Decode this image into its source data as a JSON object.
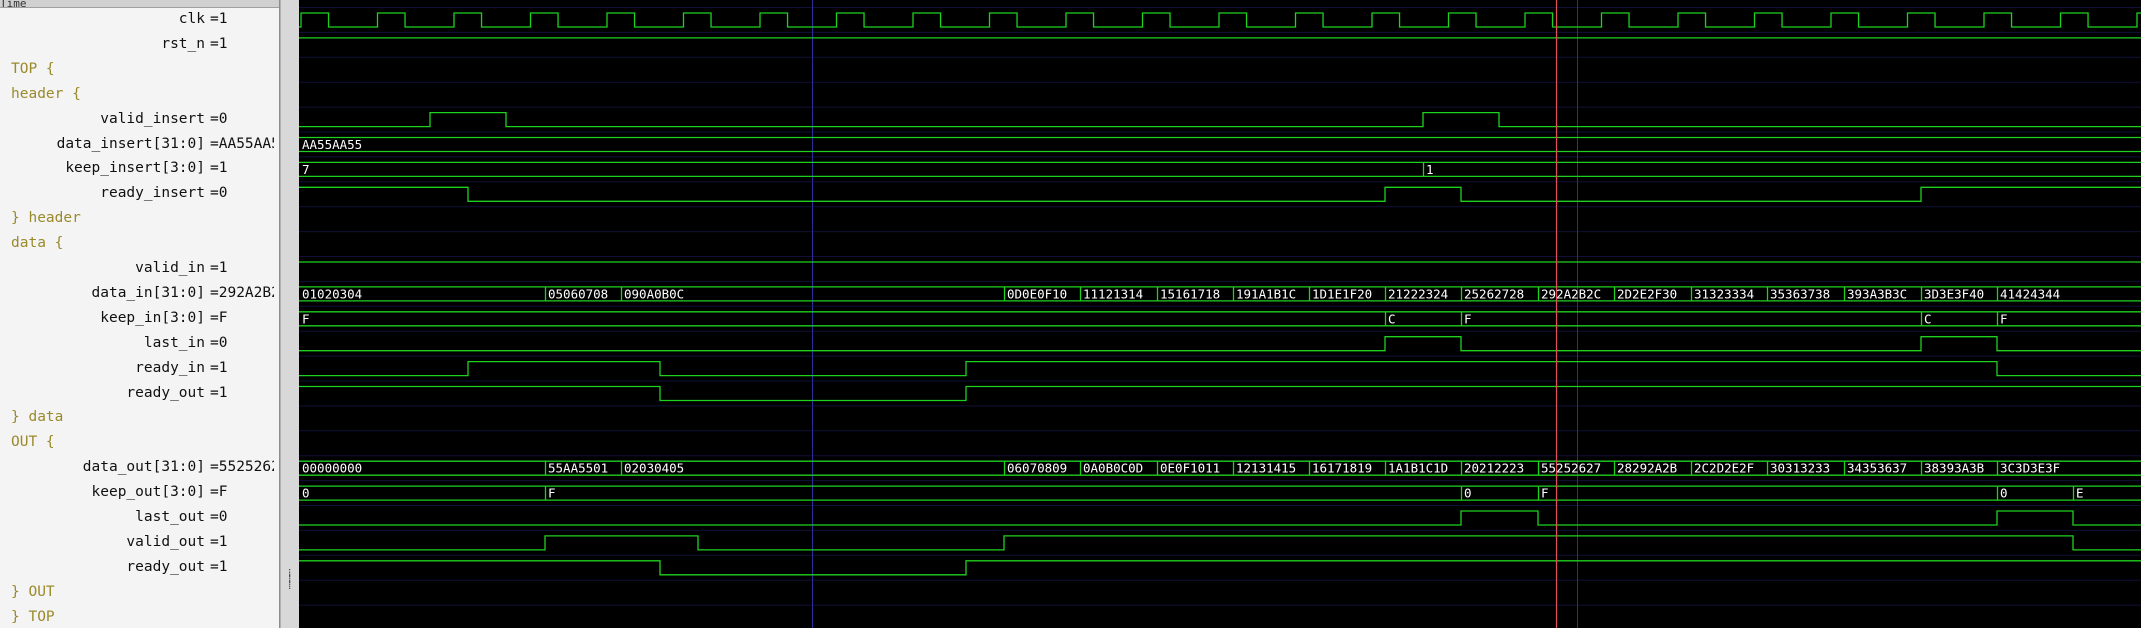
{
  "header_label": "Time",
  "rows": [
    {
      "kind": "signal",
      "name": "clk",
      "value": "1"
    },
    {
      "kind": "signal",
      "name": "rst_n",
      "value": "1"
    },
    {
      "kind": "group",
      "label": "TOP {"
    },
    {
      "kind": "group",
      "label": "header {"
    },
    {
      "kind": "signal",
      "name": "valid_insert",
      "value": "0"
    },
    {
      "kind": "signal",
      "name": "data_insert[31:0]",
      "value": "AA55AA55"
    },
    {
      "kind": "signal",
      "name": "keep_insert[3:0]",
      "value": "1"
    },
    {
      "kind": "signal",
      "name": "ready_insert",
      "value": "0"
    },
    {
      "kind": "group",
      "label": "} header"
    },
    {
      "kind": "group",
      "label": "data {"
    },
    {
      "kind": "signal",
      "name": "valid_in",
      "value": "1"
    },
    {
      "kind": "signal",
      "name": "data_in[31:0]",
      "value": "292A2B2C"
    },
    {
      "kind": "signal",
      "name": "keep_in[3:0]",
      "value": "F"
    },
    {
      "kind": "signal",
      "name": "last_in",
      "value": "0"
    },
    {
      "kind": "signal",
      "name": "ready_in",
      "value": "1"
    },
    {
      "kind": "signal",
      "name": "ready_out",
      "value": "1"
    },
    {
      "kind": "group",
      "label": "} data"
    },
    {
      "kind": "group",
      "label": "OUT {"
    },
    {
      "kind": "signal",
      "name": "data_out[31:0]",
      "value": "55252627"
    },
    {
      "kind": "signal",
      "name": "keep_out[3:0]",
      "value": "F"
    },
    {
      "kind": "signal",
      "name": "last_out",
      "value": "0"
    },
    {
      "kind": "signal",
      "name": "valid_out",
      "value": "1"
    },
    {
      "kind": "signal",
      "name": "ready_out",
      "value": "1"
    },
    {
      "kind": "group",
      "label": "} OUT"
    },
    {
      "kind": "group",
      "label": "} TOP"
    }
  ],
  "waves": {
    "clk": {
      "type": "clock",
      "period": 76.5,
      "phase": 0
    },
    "rst_n": {
      "type": "bit",
      "init": 1,
      "edges": []
    },
    "valid_insert": {
      "type": "bit",
      "init": 0,
      "edges": [
        131,
        207,
        1124,
        1200
      ]
    },
    "ready_insert": {
      "type": "bit",
      "init": 1,
      "edges": [
        169,
        1086,
        1162,
        1622
      ]
    },
    "valid_in": {
      "type": "bit",
      "init": 1,
      "edges": []
    },
    "last_in": {
      "type": "bit",
      "init": 0,
      "edges": [
        1086,
        1162,
        1622,
        1698
      ]
    },
    "ready_in": {
      "type": "bit",
      "init": 0,
      "edges": [
        169,
        361,
        667,
        1698
      ]
    },
    "ready_out_data": {
      "type": "bit",
      "init": 1,
      "edges": [
        361,
        667
      ]
    },
    "last_out": {
      "type": "bit",
      "init": 0,
      "edges": [
        1162,
        1239,
        1698,
        1774
      ]
    },
    "valid_out": {
      "type": "bit",
      "init": 0,
      "edges": [
        246,
        399,
        705,
        1774
      ]
    },
    "ready_out_out": {
      "type": "bit",
      "init": 1,
      "edges": [
        361,
        667
      ]
    },
    "data_insert": {
      "type": "bus",
      "segments": [
        {
          "t": 0,
          "v": "AA55AA55"
        }
      ]
    },
    "keep_insert": {
      "type": "bus",
      "segments": [
        {
          "t": 0,
          "v": "7"
        },
        {
          "t": 1124,
          "v": "1"
        }
      ]
    },
    "data_in": {
      "type": "bus",
      "segments": [
        {
          "t": 0,
          "v": "01020304"
        },
        {
          "t": 246,
          "v": "05060708"
        },
        {
          "t": 322,
          "v": "090A0B0C"
        },
        {
          "t": 705,
          "v": "0D0E0F10"
        },
        {
          "t": 781,
          "v": "11121314"
        },
        {
          "t": 858,
          "v": "15161718"
        },
        {
          "t": 934,
          "v": "191A1B1C"
        },
        {
          "t": 1010,
          "v": "1D1E1F20"
        },
        {
          "t": 1086,
          "v": "21222324"
        },
        {
          "t": 1162,
          "v": "25262728"
        },
        {
          "t": 1239,
          "v": "292A2B2C"
        },
        {
          "t": 1315,
          "v": "2D2E2F30"
        },
        {
          "t": 1392,
          "v": "31323334"
        },
        {
          "t": 1468,
          "v": "35363738"
        },
        {
          "t": 1545,
          "v": "393A3B3C"
        },
        {
          "t": 1622,
          "v": "3D3E3F40"
        },
        {
          "t": 1698,
          "v": "41424344"
        }
      ]
    },
    "keep_in": {
      "type": "bus",
      "segments": [
        {
          "t": 0,
          "v": "F"
        },
        {
          "t": 1086,
          "v": "C"
        },
        {
          "t": 1162,
          "v": "F"
        },
        {
          "t": 1622,
          "v": "C"
        },
        {
          "t": 1698,
          "v": "F"
        }
      ]
    },
    "data_out": {
      "type": "bus",
      "segments": [
        {
          "t": 0,
          "v": "00000000"
        },
        {
          "t": 246,
          "v": "55AA5501"
        },
        {
          "t": 322,
          "v": "02030405"
        },
        {
          "t": 705,
          "v": "06070809"
        },
        {
          "t": 781,
          "v": "0A0B0C0D"
        },
        {
          "t": 858,
          "v": "0E0F1011"
        },
        {
          "t": 934,
          "v": "12131415"
        },
        {
          "t": 1010,
          "v": "16171819"
        },
        {
          "t": 1086,
          "v": "1A1B1C1D"
        },
        {
          "t": 1162,
          "v": "20212223"
        },
        {
          "t": 1239,
          "v": "55252627"
        },
        {
          "t": 1315,
          "v": "28292A2B"
        },
        {
          "t": 1392,
          "v": "2C2D2E2F"
        },
        {
          "t": 1468,
          "v": "30313233"
        },
        {
          "t": 1545,
          "v": "34353637"
        },
        {
          "t": 1622,
          "v": "38393A3B"
        },
        {
          "t": 1698,
          "v": "3C3D3E3F"
        }
      ]
    },
    "keep_out": {
      "type": "bus",
      "segments": [
        {
          "t": 0,
          "v": "0"
        },
        {
          "t": 246,
          "v": "F"
        },
        {
          "t": 1162,
          "v": "0"
        },
        {
          "t": 1239,
          "v": "F"
        },
        {
          "t": 1698,
          "v": "0"
        },
        {
          "t": 1774,
          "v": "E"
        }
      ]
    }
  },
  "wave_rows": [
    "clk",
    "rst_n",
    null,
    null,
    "valid_insert",
    "data_insert",
    "keep_insert",
    "ready_insert",
    null,
    null,
    "valid_in",
    "data_in",
    "keep_in",
    "last_in",
    "ready_in",
    "ready_out_data",
    null,
    null,
    "data_out",
    "keep_out",
    "last_out",
    "valid_out",
    "ready_out_out",
    null,
    null
  ],
  "cursor_time": 1257,
  "markers": [
    513,
    1278
  ],
  "colors": {
    "wave": "#1fd11f",
    "cursor": "#e0525e",
    "marker": "#2d2d9a",
    "grid": "#101038",
    "bus_text": "#ffffff",
    "group_text": "#9a8a2c"
  }
}
